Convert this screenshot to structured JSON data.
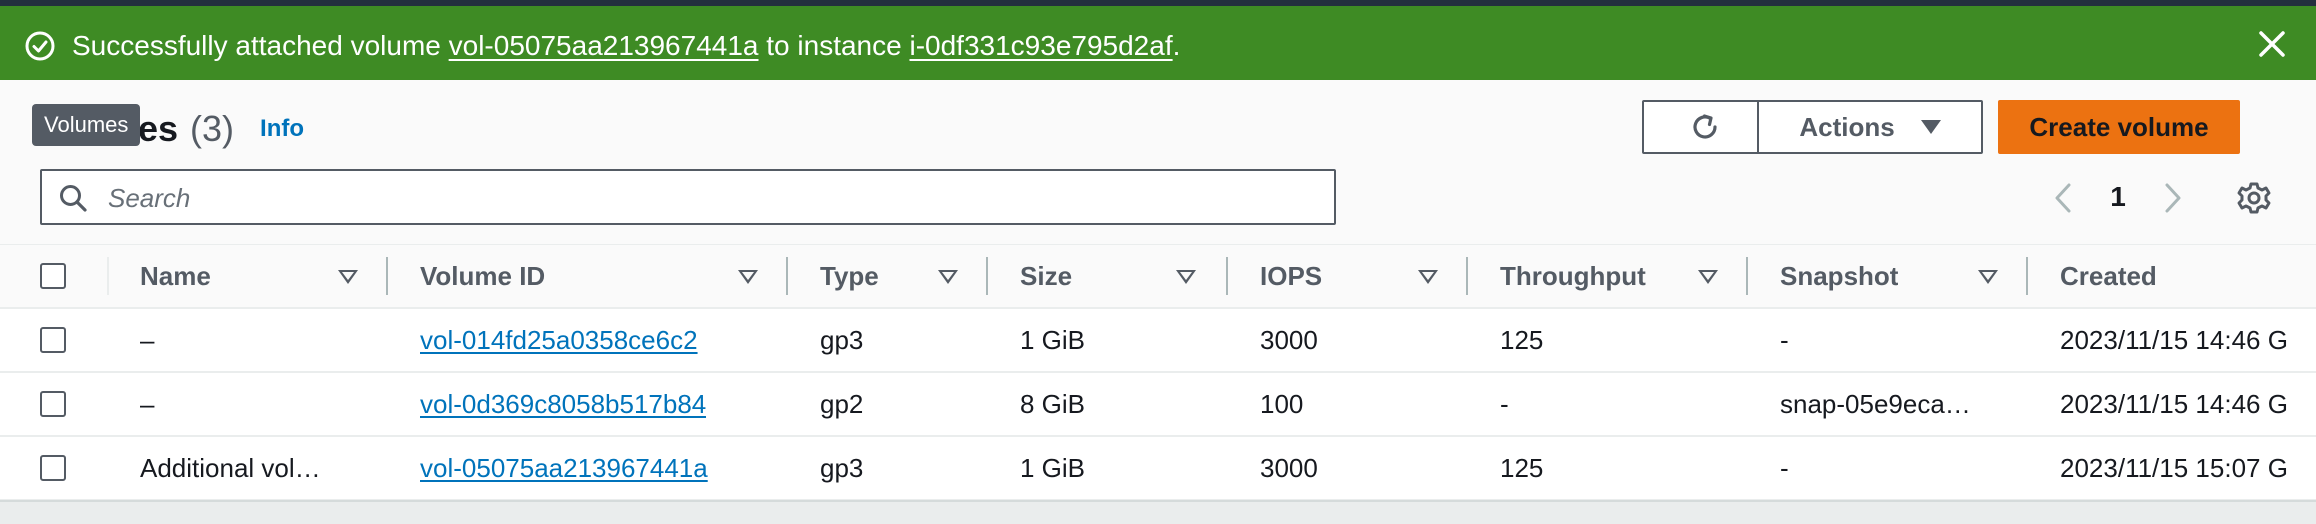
{
  "flash": {
    "prefix": "Successfully attached volume ",
    "volume_link": "vol-05075aa213967441a",
    "middle": " to instance ",
    "instance_link": "i-0df331c93e795d2af",
    "suffix": ".",
    "icon": "check-circle-icon",
    "close_icon": "close-icon",
    "color": "#3e8b24"
  },
  "header": {
    "title_visible": "es",
    "count": "(3)",
    "info": "Info",
    "tooltip": "Volumes"
  },
  "toolbar": {
    "refresh_icon": "refresh-icon",
    "actions_label": "Actions",
    "create_label": "Create volume",
    "accent": "#ec7211"
  },
  "search": {
    "placeholder": "Search",
    "value": ""
  },
  "pagination": {
    "current_page": "1"
  },
  "table": {
    "columns": [
      "Name",
      "Volume ID",
      "Type",
      "Size",
      "IOPS",
      "Throughput",
      "Snapshot",
      "Created"
    ],
    "rows": [
      {
        "name": "–",
        "volume_id": "vol-014fd25a0358ce6c2",
        "type": "gp3",
        "size": "1 GiB",
        "iops": "3000",
        "throughput": "125",
        "snapshot": "-",
        "created": "2023/11/15 14:46 G"
      },
      {
        "name": "–",
        "volume_id": "vol-0d369c8058b517b84",
        "type": "gp2",
        "size": "8 GiB",
        "iops": "100",
        "throughput": "-",
        "snapshot": "snap-05e9eca…",
        "created": "2023/11/15 14:46 G"
      },
      {
        "name": "Additional vol…",
        "volume_id": "vol-05075aa213967441a",
        "type": "gp3",
        "size": "1 GiB",
        "iops": "3000",
        "throughput": "125",
        "snapshot": "-",
        "created": "2023/11/15 15:07 G"
      }
    ]
  }
}
